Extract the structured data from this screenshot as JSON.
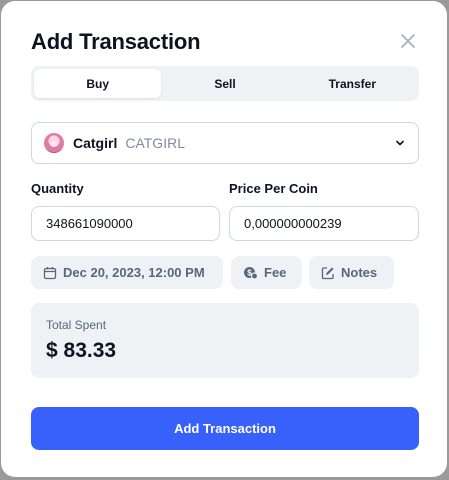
{
  "modal": {
    "title": "Add Transaction"
  },
  "tabs": [
    {
      "label": "Buy",
      "active": true
    },
    {
      "label": "Sell",
      "active": false
    },
    {
      "label": "Transfer",
      "active": false
    }
  ],
  "coin": {
    "name": "Catgirl",
    "symbol": "CATGIRL",
    "icon": "catgirl-avatar"
  },
  "quantity": {
    "label": "Quantity",
    "value": "348661090000"
  },
  "price": {
    "label": "Price Per Coin",
    "value": "0,000000000239"
  },
  "chips": {
    "date": "Dec 20, 2023, 12:00 PM",
    "fee": "Fee",
    "notes": "Notes"
  },
  "total": {
    "label": "Total Spent",
    "value": "$ 83.33"
  },
  "submit": {
    "label": "Add Transaction"
  },
  "colors": {
    "accent": "#3861fb",
    "muted_bg": "#eff2f5",
    "border": "#cfd6e4",
    "text": "#0d1421",
    "secondary_text": "#58667e"
  }
}
